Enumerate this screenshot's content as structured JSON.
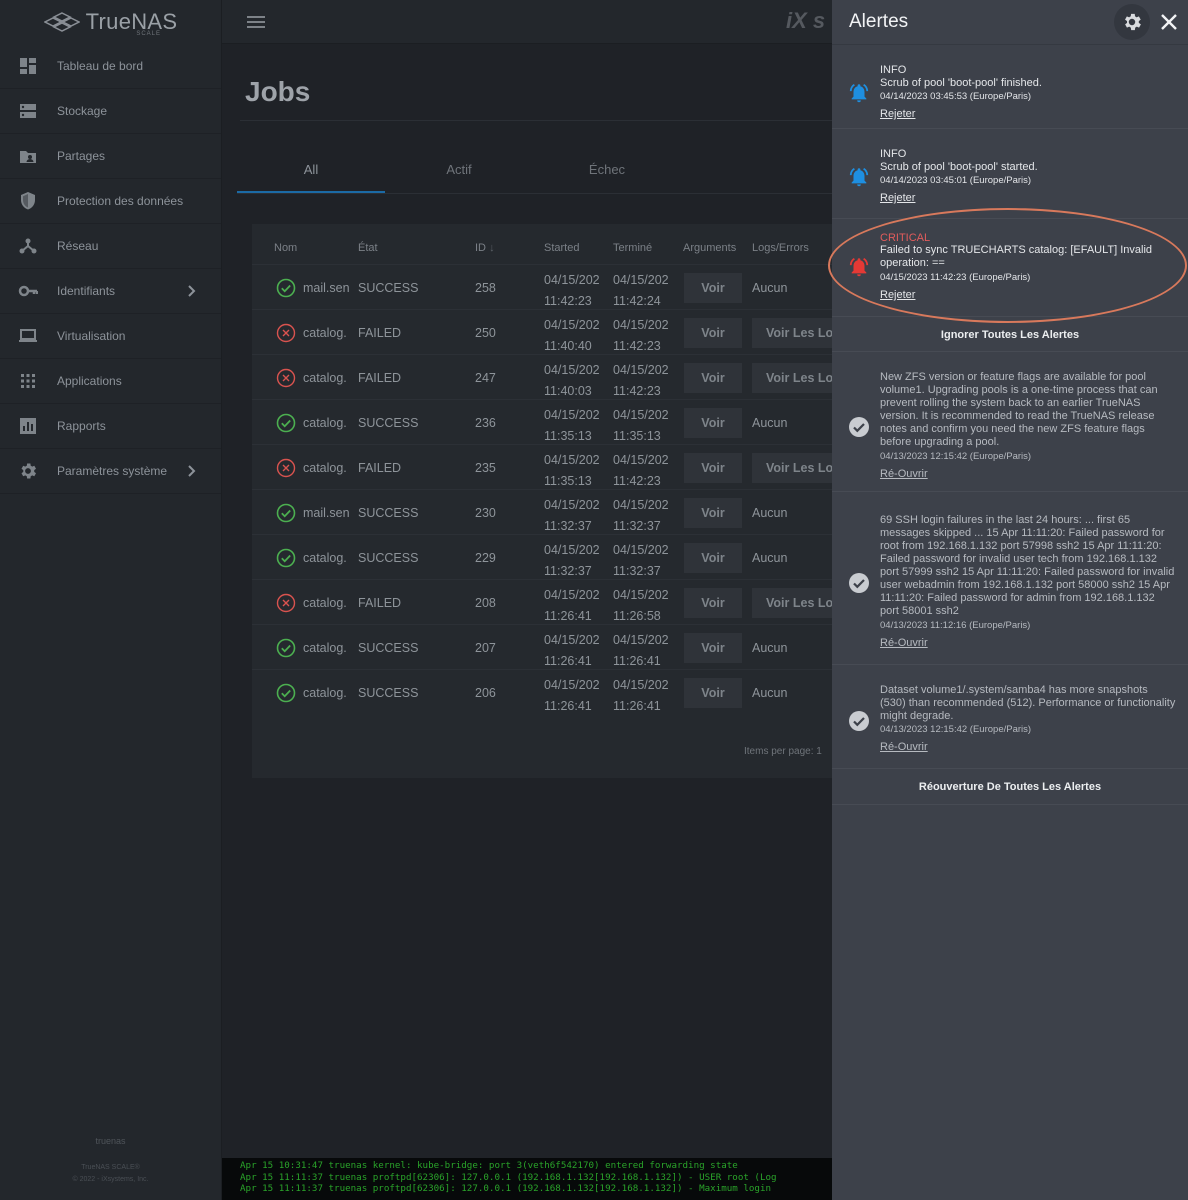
{
  "brand": {
    "name": "TrueNAS",
    "edition": "SCALE",
    "topbar_logo": "iX s"
  },
  "sidebar": {
    "items": [
      {
        "label": "Tableau de bord",
        "icon": "dashboard-icon"
      },
      {
        "label": "Stockage",
        "icon": "storage-icon"
      },
      {
        "label": "Partages",
        "icon": "shares-icon"
      },
      {
        "label": "Protection des données",
        "icon": "shield-icon"
      },
      {
        "label": "Réseau",
        "icon": "network-icon"
      },
      {
        "label": "Identifiants",
        "icon": "key-icon",
        "has_children": true
      },
      {
        "label": "Virtualisation",
        "icon": "laptop-icon"
      },
      {
        "label": "Applications",
        "icon": "apps-grid-icon"
      },
      {
        "label": "Rapports",
        "icon": "reports-icon"
      },
      {
        "label": "Paramètres système",
        "icon": "gear-icon",
        "has_children": true
      }
    ],
    "footer": {
      "hostname": "truenas",
      "product": "TrueNAS SCALE®",
      "copyright": "© 2022 - iXsystems, Inc."
    }
  },
  "main": {
    "title": "Jobs",
    "tabs": [
      {
        "label": "All",
        "active": true
      },
      {
        "label": "Actif"
      },
      {
        "label": "Échec"
      }
    ],
    "columns": {
      "name": "Nom",
      "state": "État",
      "id": "ID",
      "started": "Started",
      "finished": "Terminé",
      "arguments": "Arguments",
      "logs": "Logs/Errors"
    },
    "rows": [
      {
        "status": "success",
        "name": "mail.sen",
        "state": "SUCCESS",
        "id": "258",
        "started": [
          "04/15/202",
          "11:42:23"
        ],
        "finished": [
          "04/15/202",
          "11:42:24"
        ],
        "args": "Voir",
        "logs": "Aucun"
      },
      {
        "status": "failed",
        "name": "catalog.",
        "state": "FAILED",
        "id": "250",
        "started": [
          "04/15/202",
          "11:40:40"
        ],
        "finished": [
          "04/15/202",
          "11:42:23"
        ],
        "args": "Voir",
        "logs_btn": "Voir Les Logs"
      },
      {
        "status": "failed",
        "name": "catalog.",
        "state": "FAILED",
        "id": "247",
        "started": [
          "04/15/202",
          "11:40:03"
        ],
        "finished": [
          "04/15/202",
          "11:42:23"
        ],
        "args": "Voir",
        "logs_btn": "Voir Les Logs"
      },
      {
        "status": "success",
        "name": "catalog.",
        "state": "SUCCESS",
        "id": "236",
        "started": [
          "04/15/202",
          "11:35:13"
        ],
        "finished": [
          "04/15/202",
          "11:35:13"
        ],
        "args": "Voir",
        "logs": "Aucun"
      },
      {
        "status": "failed",
        "name": "catalog.",
        "state": "FAILED",
        "id": "235",
        "started": [
          "04/15/202",
          "11:35:13"
        ],
        "finished": [
          "04/15/202",
          "11:42:23"
        ],
        "args": "Voir",
        "logs_btn": "Voir Les Logs"
      },
      {
        "status": "success",
        "name": "mail.sen",
        "state": "SUCCESS",
        "id": "230",
        "started": [
          "04/15/202",
          "11:32:37"
        ],
        "finished": [
          "04/15/202",
          "11:32:37"
        ],
        "args": "Voir",
        "logs": "Aucun"
      },
      {
        "status": "success",
        "name": "catalog.",
        "state": "SUCCESS",
        "id": "229",
        "started": [
          "04/15/202",
          "11:32:37"
        ],
        "finished": [
          "04/15/202",
          "11:32:37"
        ],
        "args": "Voir",
        "logs": "Aucun"
      },
      {
        "status": "failed",
        "name": "catalog.",
        "state": "FAILED",
        "id": "208",
        "started": [
          "04/15/202",
          "11:26:41"
        ],
        "finished": [
          "04/15/202",
          "11:26:58"
        ],
        "args": "Voir",
        "logs_btn": "Voir Les Logs"
      },
      {
        "status": "success",
        "name": "catalog.",
        "state": "SUCCESS",
        "id": "207",
        "started": [
          "04/15/202",
          "11:26:41"
        ],
        "finished": [
          "04/15/202",
          "11:26:41"
        ],
        "args": "Voir",
        "logs": "Aucun"
      },
      {
        "status": "success",
        "name": "catalog.",
        "state": "SUCCESS",
        "id": "206",
        "started": [
          "04/15/202",
          "11:26:41"
        ],
        "finished": [
          "04/15/202",
          "11:26:41"
        ],
        "args": "Voir",
        "logs": "Aucun"
      }
    ],
    "items_per_page": "Items per page:  1"
  },
  "console": {
    "lines": [
      "Apr 15 10:31:47 truenas kernel: kube-bridge: port 3(veth6f542170) entered forwarding state",
      "Apr 15 11:11:37 truenas proftpd[62306]: 127.0.0.1 (192.168.1.132[192.168.1.132]) - USER root (Log",
      "Apr 15 11:11:37 truenas proftpd[62306]: 127.0.0.1 (192.168.1.132[192.168.1.132]) - Maximum login"
    ]
  },
  "alerts": {
    "title": "Alertes",
    "active": [
      {
        "level": "INFO",
        "message": "Scrub of pool 'boot-pool' finished.",
        "date": "04/14/2023 03:45:53 (Europe/Paris)",
        "action": "Rejeter"
      },
      {
        "level": "INFO",
        "message": "Scrub of pool 'boot-pool' started.",
        "date": "04/14/2023 03:45:01 (Europe/Paris)",
        "action": "Rejeter"
      },
      {
        "level": "CRITICAL",
        "message": "Failed to sync TRUECHARTS catalog: [EFAULT] Invalid operation: ==",
        "date": "04/15/2023 11:42:23 (Europe/Paris)",
        "action": "Rejeter"
      }
    ],
    "dismiss_all": "Ignorer Toutes Les Alertes",
    "dismissed": [
      {
        "message": "New ZFS version or feature flags are available for pool volume1. Upgrading pools is a one-time process that can prevent rolling the system back to an earlier TrueNAS version. It is recommended to read the TrueNAS release notes and confirm you need the new ZFS feature flags before upgrading a pool.",
        "date": "04/13/2023 12:15:42 (Europe/Paris)",
        "action": "Ré-Ouvrir"
      },
      {
        "message": "69 SSH login failures in the last 24 hours: ... first 65 messages skipped ... 15 Apr 11:11:20: Failed password for root from 192.168.1.132 port 57998 ssh2 15 Apr 11:11:20: Failed password for invalid user tech from 192.168.1.132 port 57999 ssh2 15 Apr 11:11:20: Failed password for invalid user webadmin from 192.168.1.132 port 58000 ssh2 15 Apr 11:11:20: Failed password for admin from 192.168.1.132 port 58001 ssh2",
        "date": "04/13/2023 11:12:16 (Europe/Paris)",
        "action": "Ré-Ouvrir"
      },
      {
        "message": "Dataset volume1/.system/samba4 has more snapshots (530) than recommended (512). Performance or functionality might degrade.",
        "date": "04/13/2023 12:15:42 (Europe/Paris)",
        "action": "Ré-Ouvrir"
      }
    ],
    "reopen_all": "Réouverture De Toutes Les Alertes"
  },
  "colors": {
    "info_bell": "#1e8fe1",
    "critical_bell": "#e53935",
    "success": "#4caf50",
    "failed": "#d9534f",
    "callout": "#d8795c",
    "accent": "#1b6aa5"
  }
}
